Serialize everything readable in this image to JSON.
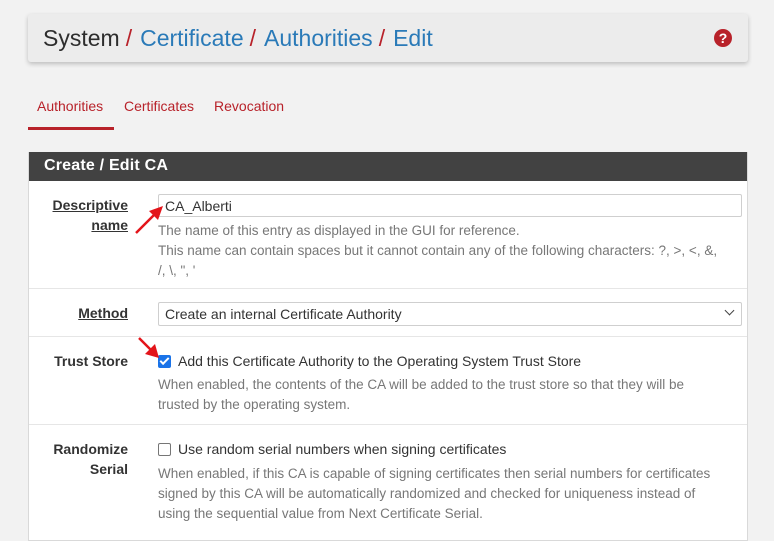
{
  "breadcrumb": {
    "items": [
      {
        "label": "System",
        "link": false
      },
      {
        "label": "Certificate",
        "link": true
      },
      {
        "label": "Authorities",
        "link": true
      },
      {
        "label": "Edit",
        "link": true
      }
    ],
    "separator": "/"
  },
  "help_icon": "?",
  "tabs": [
    {
      "label": "Authorities",
      "active": true
    },
    {
      "label": "Certificates",
      "active": false
    },
    {
      "label": "Revocation",
      "active": false
    }
  ],
  "panel": {
    "title": "Create / Edit CA",
    "fields": {
      "descriptive_name": {
        "label_line1": "Descriptive",
        "label_line2": "name",
        "value": "CA_Alberti",
        "help_line1": "The name of this entry as displayed in the GUI for reference.",
        "help_line2": "This name can contain spaces but it cannot contain any of the following characters: ?, >, <, &,",
        "help_line3": "/, \\, \", '"
      },
      "method": {
        "label": "Method",
        "selected": "Create an internal Certificate Authority"
      },
      "trust_store": {
        "label": "Trust Store",
        "checked": true,
        "checkbox_label": "Add this Certificate Authority to the Operating System Trust Store",
        "help_line1": "When enabled, the contents of the CA will be added to the trust store so that they will be",
        "help_line2": "trusted by the operating system."
      },
      "randomize_serial": {
        "label_line1": "Randomize",
        "label_line2": "Serial",
        "checked": false,
        "checkbox_label": "Use random serial numbers when signing certificates",
        "help_line1": "When enabled, if this CA is capable of signing certificates then serial numbers for certificates",
        "help_line2": "signed by this CA will be automatically randomized and checked for uniqueness instead of",
        "help_line3": "using the sequential value from Next Certificate Serial."
      }
    }
  },
  "colors": {
    "accent_red": "#b8222a",
    "link_blue": "#2a7ab8",
    "panel_heading": "#424242",
    "checkbox_blue": "#1a73e8",
    "annotation_arrow": "#e3141a"
  },
  "icons": {
    "help": "question-circle-icon",
    "select_caret": "chevron-down-icon",
    "annotation": "red-arrow-icon"
  }
}
